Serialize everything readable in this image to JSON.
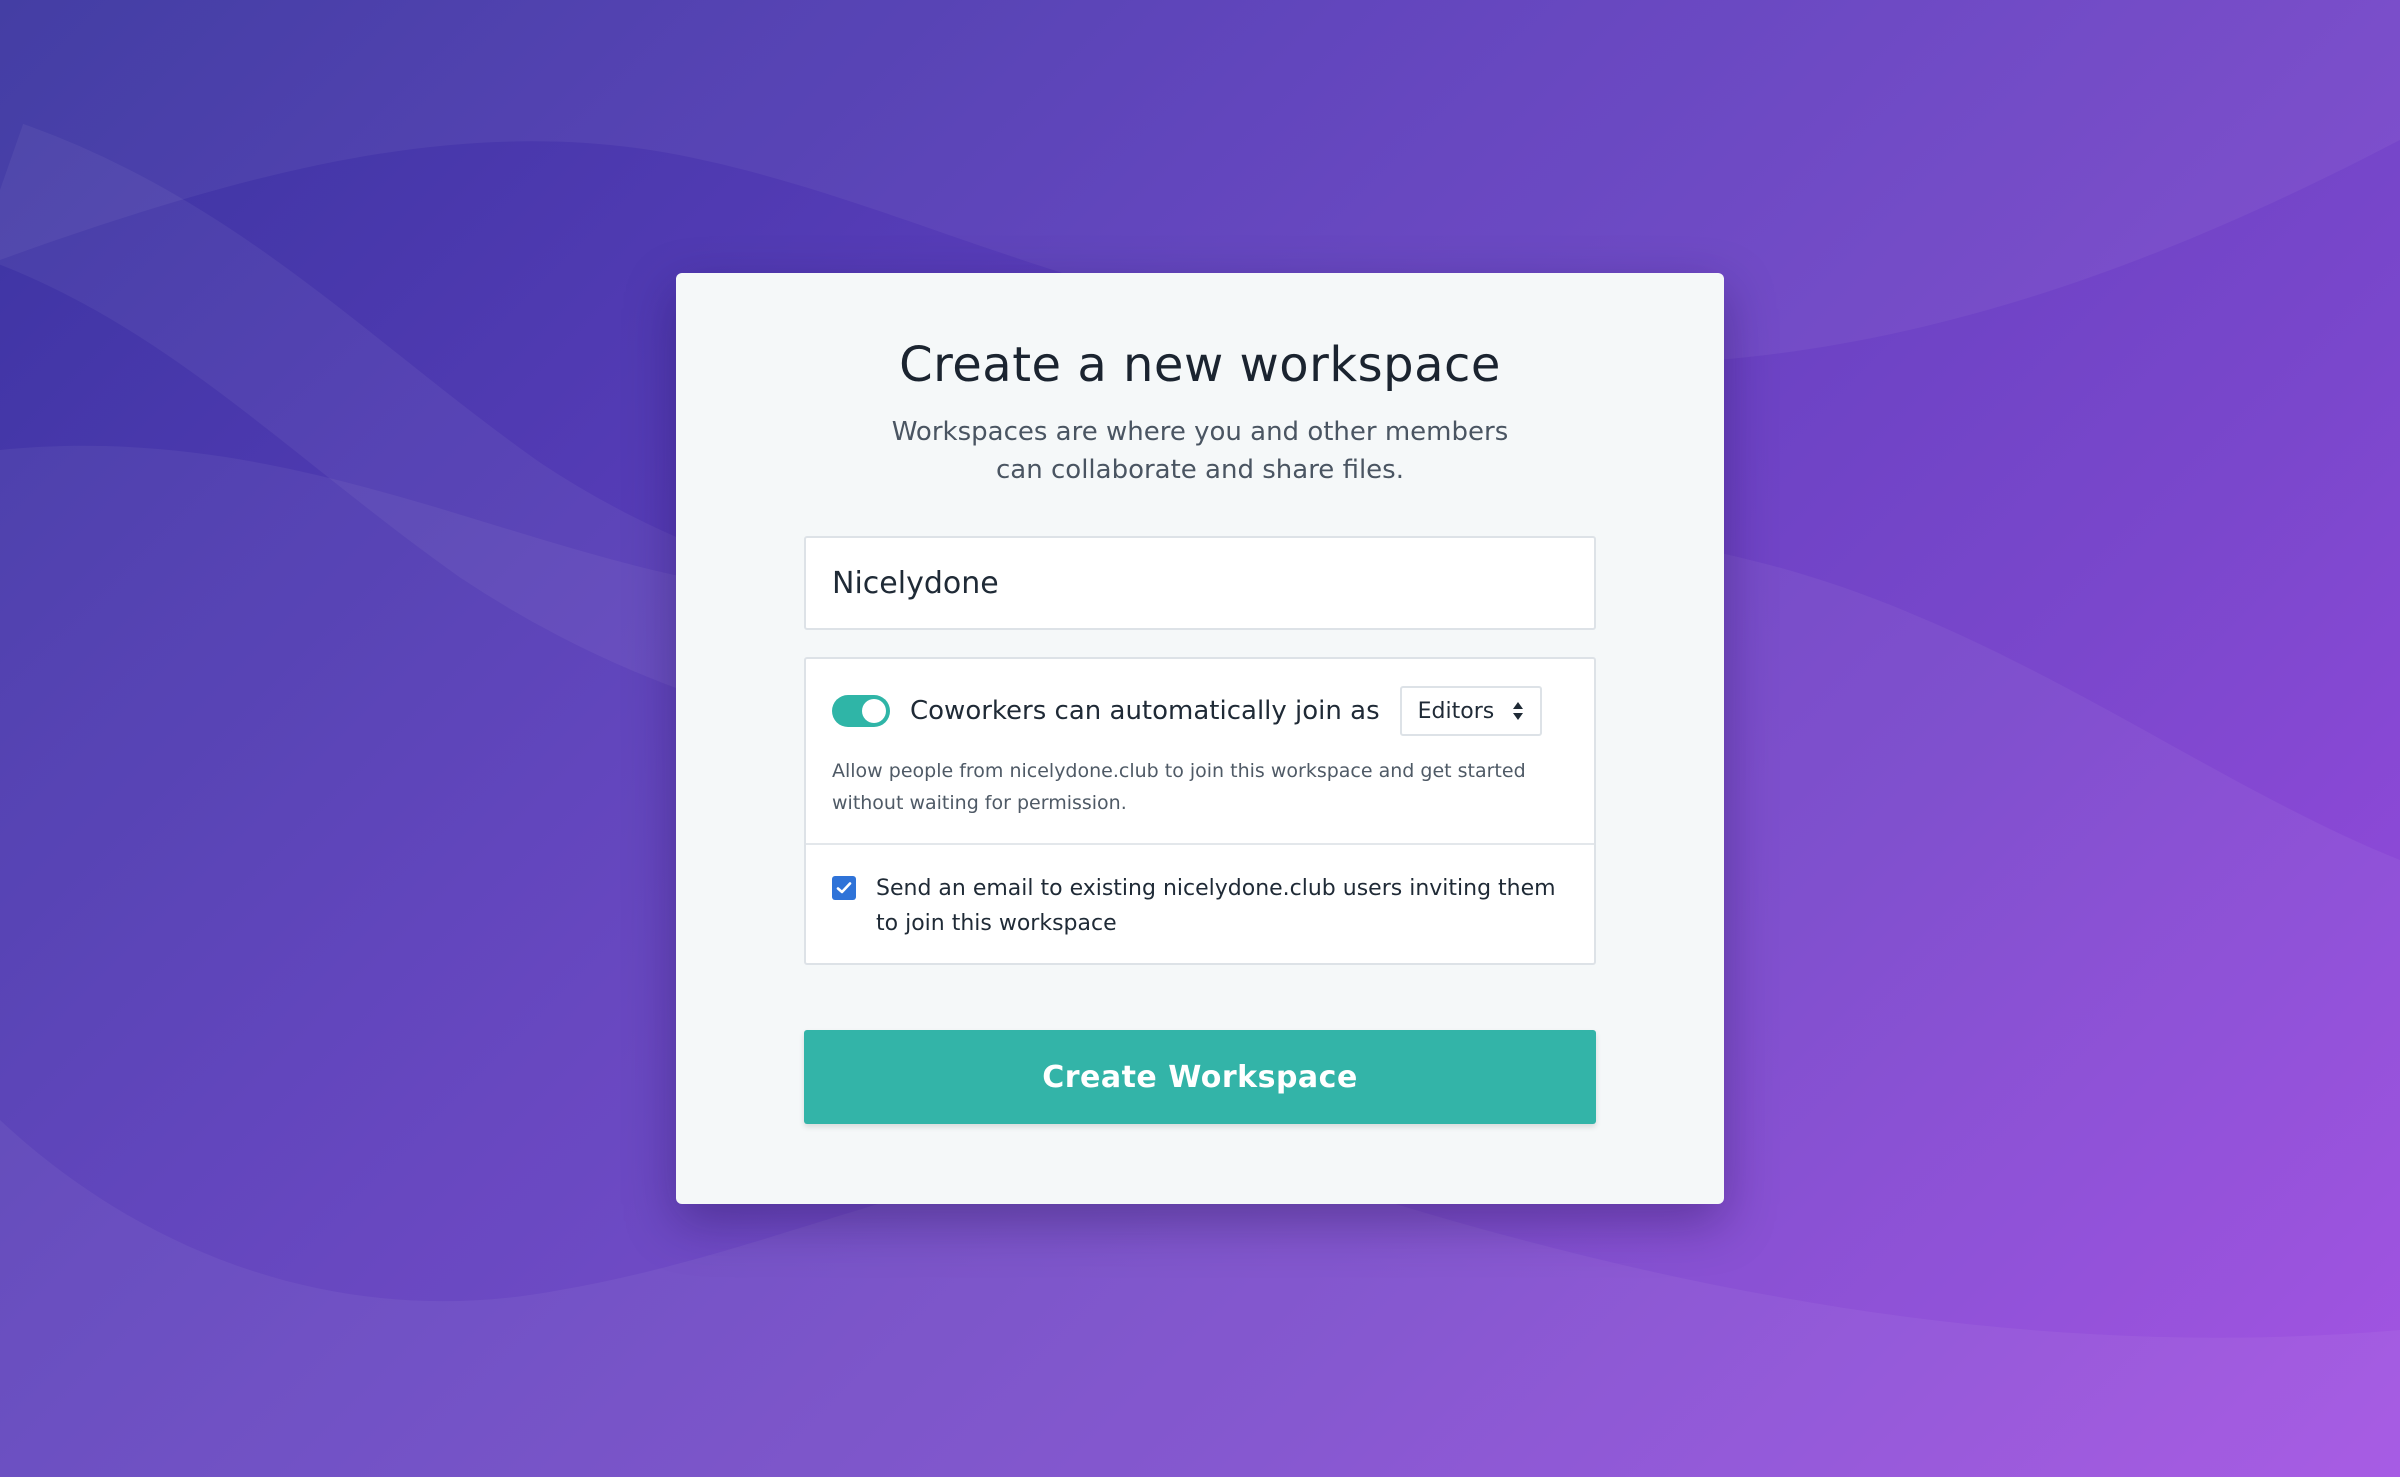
{
  "page": {
    "title": "Create a new workspace",
    "subtitle_line1": "Workspaces are where you and other members",
    "subtitle_line2": "can collaborate and share files."
  },
  "workspace_name": {
    "value": "Nicelydone",
    "placeholder": ""
  },
  "autojoin": {
    "enabled": true,
    "label": "Coworkers can automatically join as",
    "role_selected": "Editors",
    "help_text": "Allow people from nicelydone.club to join this workspace and get started without waiting for permission."
  },
  "invite_email": {
    "checked": true,
    "label": "Send an email to existing nicelydone.club users inviting them to join this workspace"
  },
  "actions": {
    "create_label": "Create Workspace"
  },
  "colors": {
    "accent_teal": "#33b4a8",
    "checkbox_blue": "#2f73d8",
    "card_background": "#f5f8f9",
    "background_start": "#3a34a0",
    "background_end": "#9f4be2"
  },
  "icons": {
    "checkbox": "check-icon",
    "select": "up-down-arrows-icon"
  }
}
